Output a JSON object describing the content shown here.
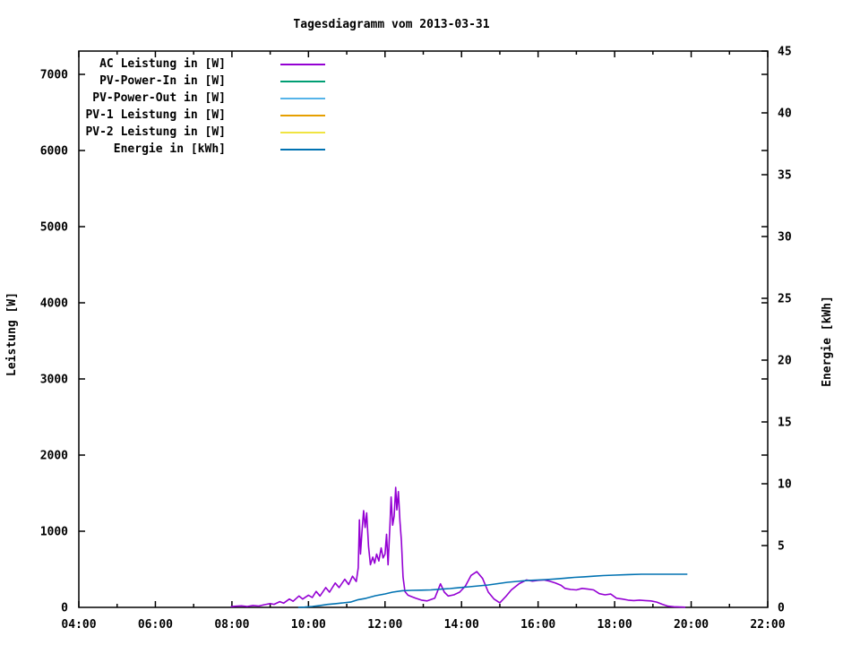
{
  "chart_data": {
    "type": "line",
    "title": "Tagesdiagramm vom 2013-03-31",
    "x": {
      "min_hour": 4,
      "max_hour": 22,
      "major_tick_labels": [
        "04:00",
        "06:00",
        "08:00",
        "10:00",
        "12:00",
        "14:00",
        "16:00",
        "18:00",
        "20:00",
        "22:00"
      ],
      "minor_tick_every_hours": 1
    },
    "y_left": {
      "label": "Leistung [W]",
      "min": 0,
      "max": 7306,
      "tick_values": [
        0,
        1000,
        2000,
        3000,
        4000,
        5000,
        6000,
        7000
      ]
    },
    "y_right": {
      "label": "Energie [kWh]",
      "min": 0,
      "max": 45,
      "tick_values": [
        0,
        5,
        10,
        15,
        20,
        25,
        30,
        35,
        40,
        45
      ]
    },
    "grid": false,
    "legend_position": "top-left-inside",
    "series": [
      {
        "name": "AC Leistung in [W]",
        "color": "#9400d3",
        "axis": "left",
        "points": [
          [
            7.97,
            10
          ],
          [
            8.1,
            15
          ],
          [
            8.25,
            20
          ],
          [
            8.4,
            12
          ],
          [
            8.55,
            25
          ],
          [
            8.7,
            18
          ],
          [
            8.85,
            35
          ],
          [
            9.0,
            50
          ],
          [
            9.1,
            40
          ],
          [
            9.25,
            75
          ],
          [
            9.35,
            55
          ],
          [
            9.5,
            110
          ],
          [
            9.6,
            80
          ],
          [
            9.75,
            150
          ],
          [
            9.85,
            110
          ],
          [
            10.0,
            160
          ],
          [
            10.1,
            130
          ],
          [
            10.2,
            210
          ],
          [
            10.3,
            150
          ],
          [
            10.45,
            260
          ],
          [
            10.55,
            200
          ],
          [
            10.7,
            320
          ],
          [
            10.8,
            260
          ],
          [
            10.95,
            370
          ],
          [
            11.05,
            300
          ],
          [
            11.15,
            410
          ],
          [
            11.25,
            340
          ],
          [
            11.3,
            520
          ],
          [
            11.33,
            1150
          ],
          [
            11.36,
            700
          ],
          [
            11.4,
            1000
          ],
          [
            11.44,
            1270
          ],
          [
            11.48,
            1050
          ],
          [
            11.52,
            1240
          ],
          [
            11.57,
            800
          ],
          [
            11.62,
            560
          ],
          [
            11.68,
            660
          ],
          [
            11.73,
            580
          ],
          [
            11.78,
            700
          ],
          [
            11.84,
            610
          ],
          [
            11.9,
            780
          ],
          [
            11.95,
            650
          ],
          [
            12.0,
            700
          ],
          [
            12.04,
            960
          ],
          [
            12.08,
            560
          ],
          [
            12.13,
            1080
          ],
          [
            12.16,
            1450
          ],
          [
            12.2,
            1080
          ],
          [
            12.24,
            1200
          ],
          [
            12.28,
            1575
          ],
          [
            12.31,
            1280
          ],
          [
            12.35,
            1520
          ],
          [
            12.39,
            1140
          ],
          [
            12.43,
            870
          ],
          [
            12.47,
            400
          ],
          [
            12.52,
            210
          ],
          [
            12.6,
            160
          ],
          [
            12.7,
            140
          ],
          [
            12.8,
            120
          ],
          [
            12.95,
            95
          ],
          [
            13.1,
            85
          ],
          [
            13.3,
            120
          ],
          [
            13.45,
            310
          ],
          [
            13.55,
            200
          ],
          [
            13.65,
            150
          ],
          [
            13.8,
            165
          ],
          [
            13.95,
            200
          ],
          [
            14.1,
            280
          ],
          [
            14.25,
            420
          ],
          [
            14.4,
            470
          ],
          [
            14.55,
            380
          ],
          [
            14.7,
            200
          ],
          [
            14.85,
            110
          ],
          [
            15.0,
            60
          ],
          [
            15.15,
            140
          ],
          [
            15.3,
            230
          ],
          [
            15.5,
            310
          ],
          [
            15.7,
            360
          ],
          [
            15.85,
            345
          ],
          [
            16.0,
            355
          ],
          [
            16.15,
            360
          ],
          [
            16.3,
            345
          ],
          [
            16.45,
            320
          ],
          [
            16.6,
            290
          ],
          [
            16.7,
            250
          ],
          [
            16.85,
            235
          ],
          [
            17.0,
            230
          ],
          [
            17.15,
            250
          ],
          [
            17.3,
            240
          ],
          [
            17.45,
            230
          ],
          [
            17.6,
            180
          ],
          [
            17.75,
            165
          ],
          [
            17.9,
            175
          ],
          [
            18.05,
            120
          ],
          [
            18.2,
            110
          ],
          [
            18.35,
            95
          ],
          [
            18.5,
            90
          ],
          [
            18.65,
            95
          ],
          [
            18.8,
            90
          ],
          [
            18.95,
            85
          ],
          [
            19.1,
            70
          ],
          [
            19.25,
            40
          ],
          [
            19.4,
            15
          ],
          [
            19.55,
            8
          ],
          [
            19.7,
            5
          ],
          [
            19.85,
            2
          ]
        ]
      },
      {
        "name": "PV-Power-In in [W]",
        "color": "#009e73",
        "axis": "left",
        "points": []
      },
      {
        "name": "PV-Power-Out in [W]",
        "color": "#56b4e9",
        "axis": "left",
        "points": []
      },
      {
        "name": "PV-1 Leistung in [W]",
        "color": "#e69f00",
        "axis": "left",
        "points": []
      },
      {
        "name": "PV-2 Leistung in [W]",
        "color": "#f0e442",
        "axis": "left",
        "points": []
      },
      {
        "name": "Energie in [kWh]",
        "color": "#0072b2",
        "axis": "right",
        "points": [
          [
            9.73,
            0
          ],
          [
            9.9,
            0.02
          ],
          [
            10.1,
            0.07
          ],
          [
            10.3,
            0.15
          ],
          [
            10.5,
            0.24
          ],
          [
            10.7,
            0.3
          ],
          [
            10.9,
            0.36
          ],
          [
            11.1,
            0.43
          ],
          [
            11.3,
            0.62
          ],
          [
            11.5,
            0.73
          ],
          [
            11.75,
            0.94
          ],
          [
            12.0,
            1.09
          ],
          [
            12.2,
            1.23
          ],
          [
            12.45,
            1.35
          ],
          [
            12.7,
            1.38
          ],
          [
            12.95,
            1.39
          ],
          [
            13.2,
            1.41
          ],
          [
            13.45,
            1.47
          ],
          [
            13.7,
            1.52
          ],
          [
            13.95,
            1.6
          ],
          [
            14.2,
            1.67
          ],
          [
            14.45,
            1.74
          ],
          [
            14.7,
            1.81
          ],
          [
            14.95,
            1.92
          ],
          [
            15.2,
            2.03
          ],
          [
            15.45,
            2.1
          ],
          [
            15.7,
            2.17
          ],
          [
            15.95,
            2.21
          ],
          [
            16.2,
            2.25
          ],
          [
            16.45,
            2.3
          ],
          [
            16.7,
            2.36
          ],
          [
            16.95,
            2.43
          ],
          [
            17.2,
            2.47
          ],
          [
            17.45,
            2.52
          ],
          [
            17.7,
            2.57
          ],
          [
            18.0,
            2.61
          ],
          [
            18.35,
            2.65
          ],
          [
            18.7,
            2.68
          ],
          [
            19.2,
            2.68
          ],
          [
            19.9,
            2.68
          ]
        ]
      }
    ]
  }
}
